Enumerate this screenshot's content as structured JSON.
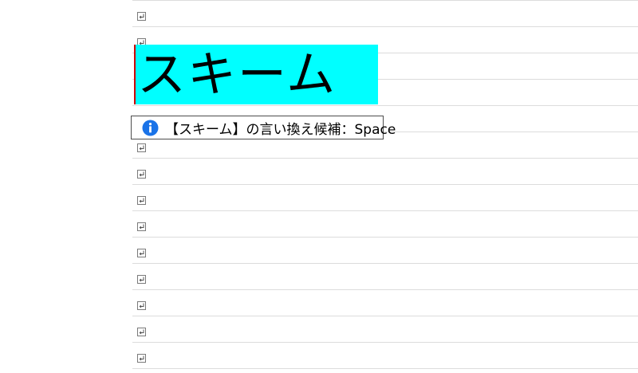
{
  "document": {
    "highlighted_text": "スキーム",
    "highlight_color": "#00ffff",
    "cursor_color": "#d00000",
    "paragraph_mark_icon": "paragraph-return-icon"
  },
  "tooltip": {
    "icon": "info-icon",
    "icon_color": "#1a73e8",
    "text": "【スキーム】の言い換え候補：Space"
  }
}
